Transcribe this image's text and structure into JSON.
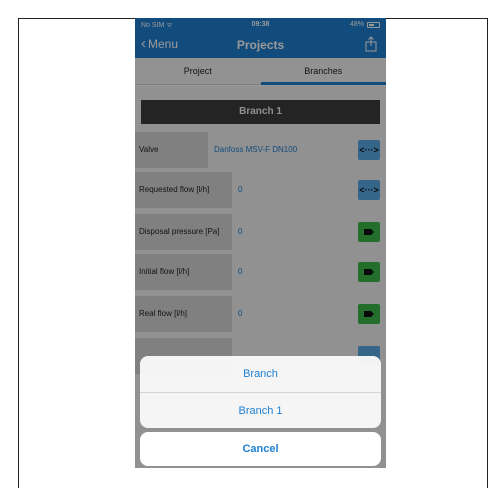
{
  "status_bar": {
    "carrier": "No SIM",
    "wifi_icon": "wifi-icon",
    "time": "09:38",
    "battery": "48%"
  },
  "nav": {
    "back_label": "Menu",
    "title": "Projects",
    "share_icon": "share-icon"
  },
  "tabs": [
    {
      "label": "Project",
      "active": false
    },
    {
      "label": "Branches",
      "active": true
    }
  ],
  "branch_header": "Branch 1",
  "rows": [
    {
      "label": "Valve",
      "value": "Danfoss MSV-F  DN100",
      "button": "blue",
      "button_icon": "<···>"
    },
    {
      "label": "Requested flow [l/h]",
      "value": "0",
      "button": "blue",
      "button_icon": "<···>"
    },
    {
      "label": "Disposal pressure [Pa]",
      "value": "0",
      "button": "green",
      "button_icon": "tag-icon"
    },
    {
      "label": "Initial flow [l/h]",
      "value": "0",
      "button": "green",
      "button_icon": "tag-icon"
    },
    {
      "label": "Real flow [l/h]",
      "value": "0",
      "button": "green",
      "button_icon": "tag-icon"
    }
  ],
  "action_sheet": {
    "items": [
      "Branch",
      "Branch 1"
    ],
    "cancel": "Cancel"
  },
  "colors": {
    "accent": "#1f7fd0",
    "green": "#3cb84a",
    "blue_button": "#5aa9e6",
    "header": "#3c3c3c"
  }
}
